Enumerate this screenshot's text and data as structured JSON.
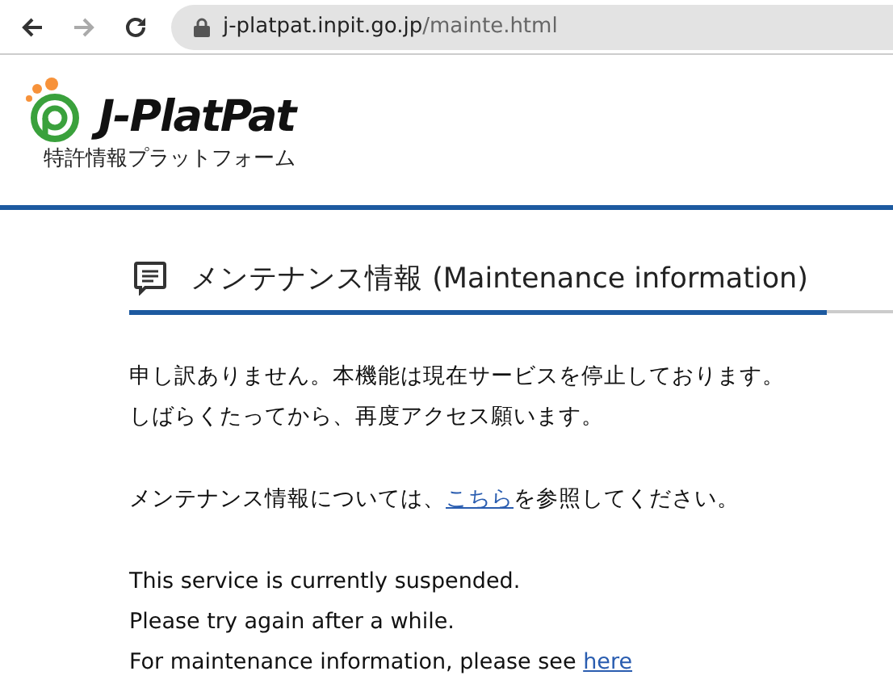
{
  "browser": {
    "url_host": "j-platpat.inpit.go.jp",
    "url_path": "/mainte.html"
  },
  "header": {
    "logo_text": "J-PlatPat",
    "subtitle": "特許情報プラットフォーム"
  },
  "section": {
    "title": "メンテナンス情報 (Maintenance information)"
  },
  "paragraphs": [
    {
      "lines": [
        {
          "text": "申し訳ありません。本機能は現在サービスを停止しております。"
        },
        {
          "text": "しばらくたってから、再度アクセス願います。"
        }
      ]
    },
    {
      "lines": [
        {
          "before": "メンテナンス情報については、",
          "link": "こちら",
          "after": "を参照してください。"
        }
      ]
    },
    {
      "lines": [
        {
          "text": "This service is currently suspended."
        },
        {
          "text": "Please try again after a while."
        },
        {
          "before": "For maintenance information, please see ",
          "link": "here"
        }
      ]
    }
  ]
}
